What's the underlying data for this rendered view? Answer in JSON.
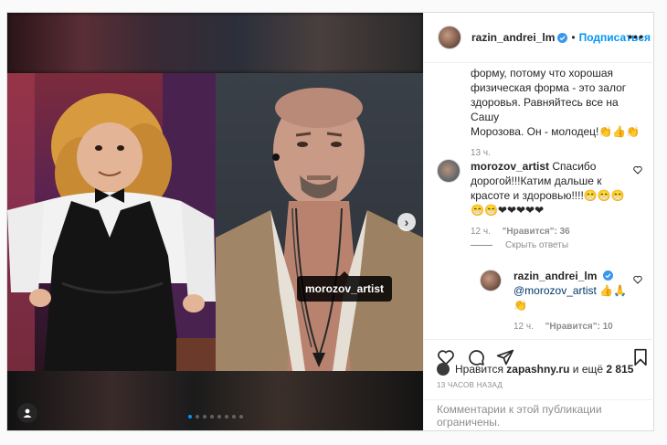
{
  "post": {
    "author": "razin_andrei_lm",
    "follow_label": "Подписаться",
    "separator": "•",
    "more": "•••"
  },
  "media": {
    "tag_label": "morozov_artist",
    "carousel_total": 8,
    "carousel_active": 1
  },
  "comments": {
    "first_text_1": "форму, потому что хорошая",
    "first_text_2": "физическая форма - это залог",
    "first_text_3": "здоровья. Равняйтесь все на Сашу",
    "first_text_4": "Морозова. Он - молодец!👏👍👏",
    "first_time": "13 ч.",
    "second_user": "morozov_artist",
    "second_text_1": "Спасибо",
    "second_text_2": "дорогой!!!Катим дальше к",
    "second_text_3": "красоте и здоровью!!!!😁😁😁",
    "second_text_4": "😁😁❤❤❤❤❤",
    "second_time": "12 ч.",
    "second_likes": "\"Нравится\": 36",
    "hide_replies": "Скрыть ответы",
    "reply_user": "razin_andrei_lm",
    "reply_mention": "@morozov_artist",
    "reply_emoji_1": "👍🙏",
    "reply_emoji_2": "👏",
    "reply_time": "12 ч.",
    "reply_likes": "\"Нравится\": 10"
  },
  "footer": {
    "likes_prefix": "Нравится",
    "likes_user": "zapashny.ru",
    "likes_suffix": "и ещё",
    "likes_count": "2 815",
    "time_ago": "13 ЧАСОВ НАЗАД",
    "comments_limited": "Комментарии к этой публикации ограничены."
  },
  "colors": {
    "accent": "#0095f6",
    "muted": "#8e8e8e",
    "verified": "#3897f0"
  }
}
